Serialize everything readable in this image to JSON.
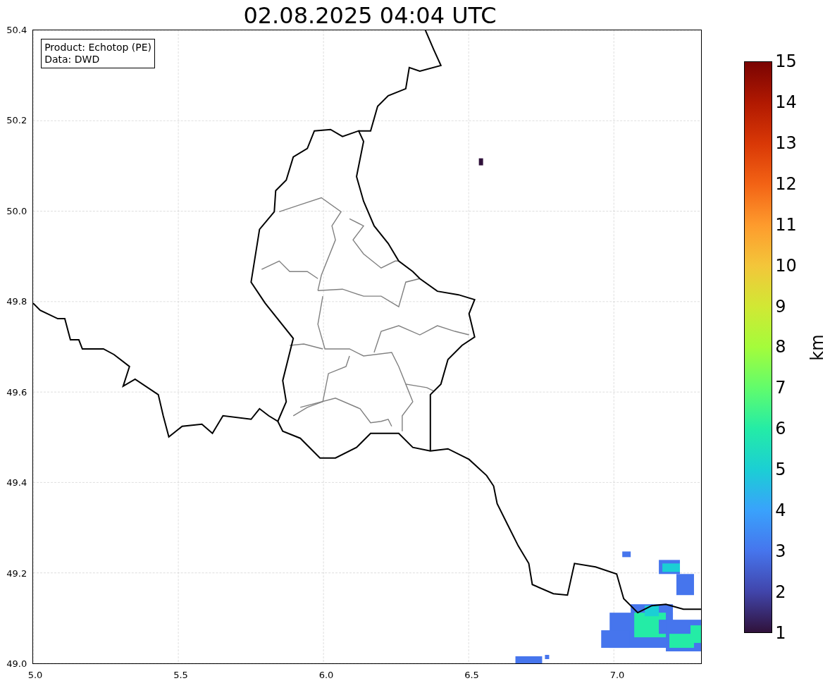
{
  "title": "02.08.2025 04:04 UTC",
  "legend": [
    "Product: Echotop (PE)",
    "Data: DWD"
  ],
  "map": {
    "yticks": [
      "50.4",
      "50.2",
      "50.0",
      "49.8",
      "49.6",
      "49.4",
      "49.2",
      "49.0"
    ],
    "xticks": [
      "5.0",
      "5.5",
      "6.0",
      "6.5",
      "7.0"
    ]
  },
  "colorbar": {
    "label": "km",
    "ticks": [
      "15",
      "14",
      "13",
      "12",
      "11",
      "10",
      "9",
      "8",
      "7",
      "6",
      "5",
      "4",
      "3",
      "2",
      "1"
    ]
  }
}
